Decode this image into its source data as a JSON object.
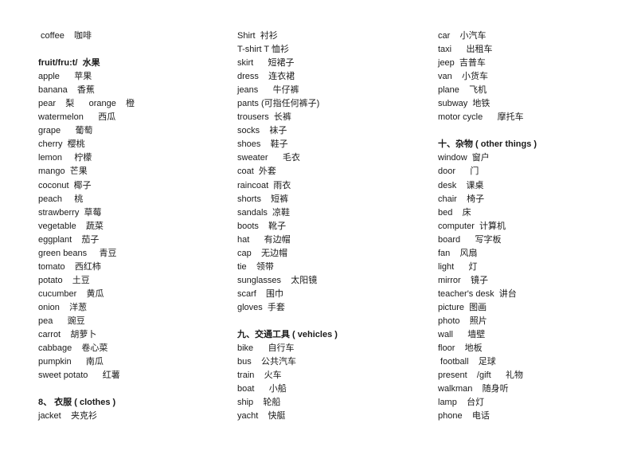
{
  "columns": [
    {
      "lines": [
        {
          "type": "entry",
          "text": " coffee    咖啡"
        },
        {
          "type": "blank"
        },
        {
          "type": "header",
          "text": "fruit/fru:t/  水果"
        },
        {
          "type": "entry",
          "text": "apple      苹果"
        },
        {
          "type": "entry",
          "text": "banana    香蕉"
        },
        {
          "type": "entry",
          "text": "pear    梨      orange    橙"
        },
        {
          "type": "entry",
          "text": "watermelon      西瓜"
        },
        {
          "type": "entry",
          "text": "grape      葡萄"
        },
        {
          "type": "entry",
          "text": "cherry  樱桃"
        },
        {
          "type": "entry",
          "text": "lemon     柠檬"
        },
        {
          "type": "entry",
          "text": "mango  芒果"
        },
        {
          "type": "entry",
          "text": "coconut  椰子"
        },
        {
          "type": "entry",
          "text": "peach     桃"
        },
        {
          "type": "entry",
          "text": "strawberry  草莓"
        },
        {
          "type": "entry",
          "text": "vegetable    蔬菜"
        },
        {
          "type": "entry",
          "text": "eggplant    茄子"
        },
        {
          "type": "entry",
          "text": "green beans     青豆"
        },
        {
          "type": "entry",
          "text": "tomato    西红柿"
        },
        {
          "type": "entry",
          "text": "potato    土豆"
        },
        {
          "type": "entry",
          "text": "cucumber    黄瓜"
        },
        {
          "type": "entry",
          "text": "onion    洋葱"
        },
        {
          "type": "entry",
          "text": "pea      豌豆"
        },
        {
          "type": "entry",
          "text": "carrot    胡萝卜"
        },
        {
          "type": "entry",
          "text": "cabbage    卷心菜"
        },
        {
          "type": "entry",
          "text": "pumpkin      南瓜"
        },
        {
          "type": "entry",
          "text": "sweet potato      红薯"
        },
        {
          "type": "blank"
        },
        {
          "type": "header",
          "text": "8、 衣服 ( clothes )"
        },
        {
          "type": "entry",
          "text": "jacket    夹克衫"
        }
      ]
    },
    {
      "lines": [
        {
          "type": "entry",
          "text": "Shirt  衬衫"
        },
        {
          "type": "entry",
          "text": "T-shirt T 恤衫"
        },
        {
          "type": "entry",
          "text": "skirt      短裙子"
        },
        {
          "type": "entry",
          "text": "dress    连衣裙"
        },
        {
          "type": "entry",
          "text": "jeans      牛仔裤"
        },
        {
          "type": "entry",
          "text": "pants (可指任何裤子)"
        },
        {
          "type": "entry",
          "text": "trousers  长裤"
        },
        {
          "type": "entry",
          "text": "socks    袜子"
        },
        {
          "type": "entry",
          "text": "shoes    鞋子"
        },
        {
          "type": "entry",
          "text": "sweater      毛衣"
        },
        {
          "type": "entry",
          "text": "coat  外套"
        },
        {
          "type": "entry",
          "text": "raincoat  雨衣"
        },
        {
          "type": "entry",
          "text": "shorts    短裤"
        },
        {
          "type": "entry",
          "text": "sandals  凉鞋"
        },
        {
          "type": "entry",
          "text": "boots    靴子"
        },
        {
          "type": "entry",
          "text": "hat      有边帽"
        },
        {
          "type": "entry",
          "text": "cap    无边帽"
        },
        {
          "type": "entry",
          "text": "tie    领带"
        },
        {
          "type": "entry",
          "text": "sunglasses    太阳镜"
        },
        {
          "type": "entry",
          "text": "scarf    围巾"
        },
        {
          "type": "entry",
          "text": "gloves  手套"
        },
        {
          "type": "blank"
        },
        {
          "type": "header",
          "text": "九、交通工具 ( vehicles )"
        },
        {
          "type": "entry",
          "text": "bike      自行车"
        },
        {
          "type": "entry",
          "text": "bus    公共汽车"
        },
        {
          "type": "entry",
          "text": "train    火车"
        },
        {
          "type": "entry",
          "text": "boat      小船"
        },
        {
          "type": "entry",
          "text": "ship    轮船"
        },
        {
          "type": "entry",
          "text": "yacht    快艇"
        }
      ]
    },
    {
      "lines": [
        {
          "type": "entry",
          "text": "car    小汽车"
        },
        {
          "type": "entry",
          "text": "taxi      出租车"
        },
        {
          "type": "entry",
          "text": "jeep  吉普车"
        },
        {
          "type": "entry",
          "text": "van    小货车"
        },
        {
          "type": "entry",
          "text": "plane    飞机"
        },
        {
          "type": "entry",
          "text": "subway  地铁"
        },
        {
          "type": "entry",
          "text": "motor cycle      摩托车"
        },
        {
          "type": "blank"
        },
        {
          "type": "header",
          "text": "十、杂物 ( other things )"
        },
        {
          "type": "entry",
          "text": "window  窗户"
        },
        {
          "type": "entry",
          "text": "door      门"
        },
        {
          "type": "entry",
          "text": "desk    课桌"
        },
        {
          "type": "entry",
          "text": "chair    椅子"
        },
        {
          "type": "entry",
          "text": "bed    床"
        },
        {
          "type": "entry",
          "text": "computer  计算机"
        },
        {
          "type": "entry",
          "text": "board      写字板"
        },
        {
          "type": "entry",
          "text": "fan    风扇"
        },
        {
          "type": "entry",
          "text": "light      灯"
        },
        {
          "type": "entry",
          "text": "mirror    镜子"
        },
        {
          "type": "entry",
          "text": "teacher's desk  讲台"
        },
        {
          "type": "entry",
          "text": "picture  图画"
        },
        {
          "type": "entry",
          "text": "photo    照片"
        },
        {
          "type": "entry",
          "text": "wall      墙壁"
        },
        {
          "type": "entry",
          "text": "floor    地板"
        },
        {
          "type": "entry",
          "text": " football    足球"
        },
        {
          "type": "entry",
          "text": "present    /gift      礼物"
        },
        {
          "type": "entry",
          "text": "walkman    随身听"
        },
        {
          "type": "entry",
          "text": "lamp    台灯"
        },
        {
          "type": "entry",
          "text": "phone    电话"
        }
      ]
    }
  ]
}
